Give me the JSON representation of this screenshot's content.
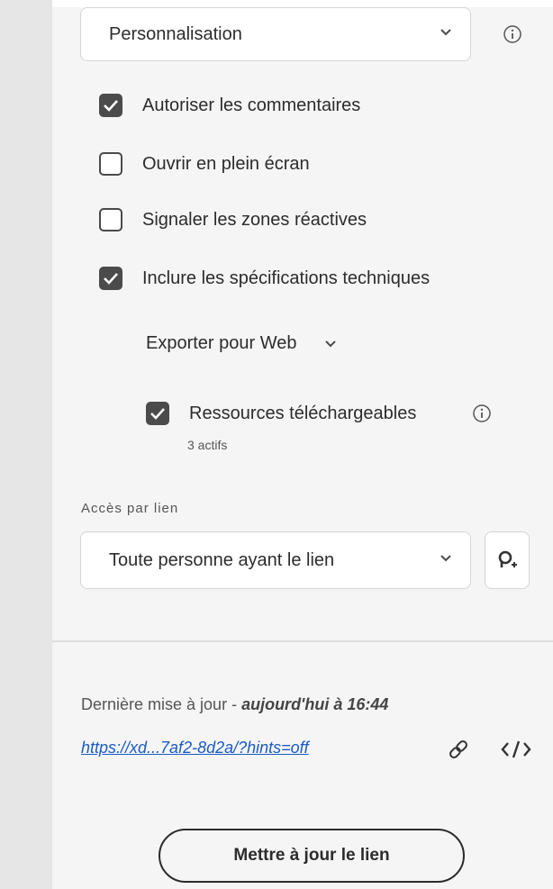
{
  "preset_select": {
    "value": "Personnalisation"
  },
  "options": [
    {
      "label": "Autoriser les commentaires",
      "checked": true
    },
    {
      "label": "Ouvrir en plein écran",
      "checked": false
    },
    {
      "label": "Signaler les zones réactives",
      "checked": false
    },
    {
      "label": "Inclure les spécifications techniques",
      "checked": true
    }
  ],
  "export": {
    "label": "Exporter pour Web",
    "resources_label": "Ressources téléchargeables",
    "resources_checked": true,
    "resources_count": "3 actifs"
  },
  "link_access": {
    "section_label": "Accès par lien",
    "value": "Toute personne ayant le lien"
  },
  "footer": {
    "update_prefix": "Dernière mise à jour - ",
    "update_time": "aujourd'hui à 16:44",
    "url": "https://xd...7af2-8d2a/?hints=off",
    "update_button": "Mettre à jour le lien"
  },
  "icons": {
    "info": "info-icon",
    "chevron": "chevron-down-icon",
    "invite": "invite-user-icon",
    "link": "link-icon",
    "embed": "embed-code-icon"
  },
  "colors": {
    "checkbox_checked": "#4b4b4b",
    "link": "#1a5bc4",
    "panel_bg": "#f5f5f5"
  }
}
